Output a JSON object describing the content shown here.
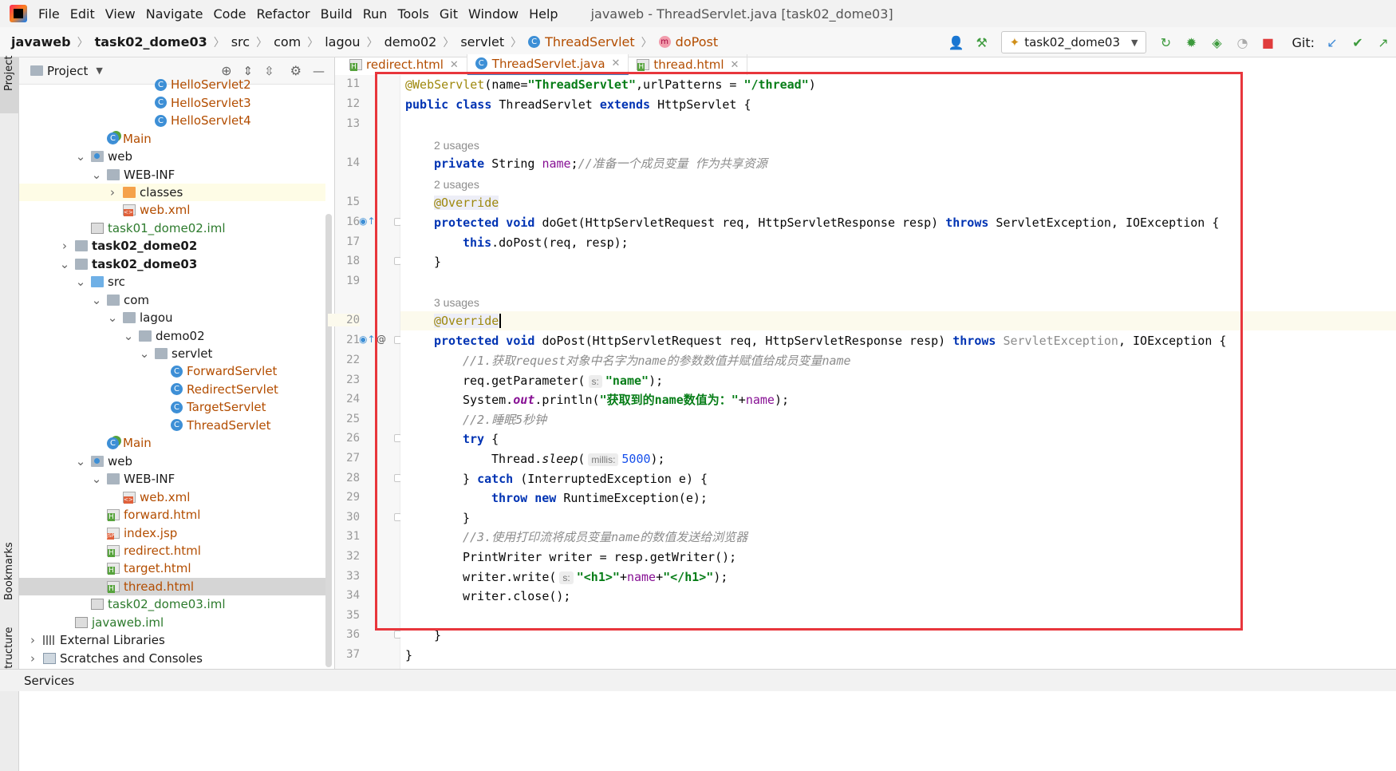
{
  "menu": {
    "items": [
      "File",
      "Edit",
      "View",
      "Navigate",
      "Code",
      "Refactor",
      "Build",
      "Run",
      "Tools",
      "Git",
      "Window",
      "Help"
    ],
    "window_title": "javaweb - ThreadServlet.java [task02_dome03]"
  },
  "breadcrumb": {
    "items": [
      "javaweb",
      "task02_dome03",
      "src",
      "com",
      "lagou",
      "demo02",
      "servlet",
      "ThreadServlet",
      "doPost"
    ]
  },
  "toolbar": {
    "run_config": "task02_dome03",
    "git_label": "Git:"
  },
  "project_panel": {
    "title": "Project",
    "side_labels": [
      "Project",
      "Bookmarks",
      "Structure"
    ],
    "tree": [
      {
        "label": "HelloServlet2",
        "icon": "class-icon",
        "color": "orange"
      },
      {
        "label": "HelloServlet3",
        "icon": "class-icon",
        "color": "orange"
      },
      {
        "label": "HelloServlet4",
        "icon": "class-icon",
        "color": "orange"
      },
      {
        "label": "Main",
        "icon": "main-class-icon",
        "color": "orange"
      },
      {
        "label": "web",
        "icon": "web-folder-icon",
        "color": "black"
      },
      {
        "label": "WEB-INF",
        "icon": "folder-icon",
        "color": "black"
      },
      {
        "label": "classes",
        "icon": "excluded-folder-icon",
        "color": "black"
      },
      {
        "label": "web.xml",
        "icon": "xml-file-icon",
        "color": "orange"
      },
      {
        "label": "task01_dome02.iml",
        "icon": "iml-file-icon",
        "color": "green"
      },
      {
        "label": "task02_dome02",
        "icon": "module-folder-icon",
        "color": "black"
      },
      {
        "label": "task02_dome03",
        "icon": "module-folder-icon",
        "color": "black"
      },
      {
        "label": "src",
        "icon": "source-folder-icon",
        "color": "black"
      },
      {
        "label": "com",
        "icon": "package-icon",
        "color": "black"
      },
      {
        "label": "lagou",
        "icon": "package-icon",
        "color": "black"
      },
      {
        "label": "demo02",
        "icon": "package-icon",
        "color": "black"
      },
      {
        "label": "servlet",
        "icon": "package-icon",
        "color": "black"
      },
      {
        "label": "ForwardServlet",
        "icon": "class-icon",
        "color": "orange"
      },
      {
        "label": "RedirectServlet",
        "icon": "class-icon",
        "color": "orange"
      },
      {
        "label": "TargetServlet",
        "icon": "class-icon",
        "color": "orange"
      },
      {
        "label": "ThreadServlet",
        "icon": "class-icon",
        "color": "orange"
      },
      {
        "label": "Main",
        "icon": "main-class-icon",
        "color": "orange"
      },
      {
        "label": "web",
        "icon": "web-folder-icon",
        "color": "black"
      },
      {
        "label": "WEB-INF",
        "icon": "folder-icon",
        "color": "black"
      },
      {
        "label": "web.xml",
        "icon": "xml-file-icon",
        "color": "orange"
      },
      {
        "label": "forward.html",
        "icon": "html-file-icon",
        "color": "orange"
      },
      {
        "label": "index.jsp",
        "icon": "jsp-file-icon",
        "color": "orange"
      },
      {
        "label": "redirect.html",
        "icon": "html-file-icon",
        "color": "orange"
      },
      {
        "label": "target.html",
        "icon": "html-file-icon",
        "color": "orange"
      },
      {
        "label": "thread.html",
        "icon": "html-file-icon",
        "color": "orange"
      },
      {
        "label": "task02_dome03.iml",
        "icon": "iml-file-icon",
        "color": "green"
      },
      {
        "label": "javaweb.iml",
        "icon": "iml-file-icon",
        "color": "green"
      },
      {
        "label": "External Libraries",
        "icon": "library-icon",
        "color": "black"
      },
      {
        "label": "Scratches and Consoles",
        "icon": "scratch-icon",
        "color": "black"
      }
    ]
  },
  "tabs": [
    {
      "label": "redirect.html",
      "active": false
    },
    {
      "label": "ThreadServlet.java",
      "active": true
    },
    {
      "label": "thread.html",
      "active": false
    }
  ],
  "editor": {
    "line_numbers": [
      "11",
      "12",
      "13",
      "14",
      "15",
      "16",
      "17",
      "18",
      "19",
      "20",
      "21",
      "22",
      "23",
      "24",
      "25",
      "26",
      "27",
      "28",
      "29",
      "30",
      "31",
      "32",
      "33",
      "34",
      "35",
      "36",
      "37"
    ],
    "usages": [
      "2 usages",
      "2 usages",
      "3 usages"
    ],
    "code": {
      "l11_ann": "@WebServlet",
      "l11_a": "(name=",
      "l11_s1": "\"ThreadServlet\"",
      "l11_b": ",urlPatterns = ",
      "l11_s2": "\"/thread\"",
      "l11_c": ")",
      "l12_kw1": "public class ",
      "l12_a": "ThreadServlet ",
      "l12_kw2": "extends ",
      "l12_b": "HttpServlet {",
      "l14_kw": "private ",
      "l14_a": "String ",
      "l14_fld": "name",
      "l14_b": ";",
      "l14_cmt": "//准备一个成员变量 作为共享资源",
      "l15_ann": "@Override",
      "l16_kw1": "protected void ",
      "l16_a": "doGet(HttpServletRequest req, HttpServletResponse resp) ",
      "l16_kw2": "throws ",
      "l16_b": "ServletException, IOException {",
      "l17_kw": "this",
      "l17_a": ".doPost(req, resp);",
      "l18": "}",
      "l20_ann": "@Override",
      "l21_kw1": "protected void ",
      "l21_a": "doPost(HttpServletRequest req, HttpServletResponse resp) ",
      "l21_kw2": "throws ",
      "l21_gray": "ServletException",
      "l21_b": ", IOException {",
      "l22_cmt": "//1.获取request对象中名字为name的参数数值并赋值给成员变量name",
      "l23_a": "req.getParameter(",
      "l23_hint": "s:",
      "l23_str": "\"name\"",
      "l23_b": ");",
      "l24_a": "System.",
      "l24_out": "out",
      "l24_b": ".println(",
      "l24_str": "\"获取到的name数值为：\"",
      "l24_c": "+",
      "l24_fld": "name",
      "l24_d": ");",
      "l25_cmt": "//2.睡眠5秒钟",
      "l26_kw": "try ",
      "l26_a": "{",
      "l27_a": "Thread.",
      "l27_sleep": "sleep",
      "l27_b": "(",
      "l27_hint": "millis:",
      "l27_num": "5000",
      "l27_c": ");",
      "l28_a": "} ",
      "l28_kw": "catch ",
      "l28_b": "(InterruptedException e) {",
      "l29_kw1": "throw ",
      "l29_kw2": "new ",
      "l29_a": "RuntimeException(e);",
      "l30": "}",
      "l31_cmt": "//3.使用打印流将成员变量name的数值发送给浏览器",
      "l32_a": "PrintWriter writer = resp.getWriter();",
      "l33_a": "writer.write(",
      "l33_hint": "s:",
      "l33_s1": "\"<h1>\"",
      "l33_b": "+",
      "l33_fld": "name",
      "l33_c": "+",
      "l33_s2": "\"</h1>\"",
      "l33_d": ");",
      "l34": "writer.close();",
      "l36": "}",
      "l37": "}"
    }
  },
  "status_bar": {
    "label": "Services"
  },
  "colors": {
    "keyword": "#0033b3",
    "string": "#067d17",
    "annotation": "#9e880d",
    "comment": "#8c8c8c",
    "highlight_box": "#e8363c"
  }
}
